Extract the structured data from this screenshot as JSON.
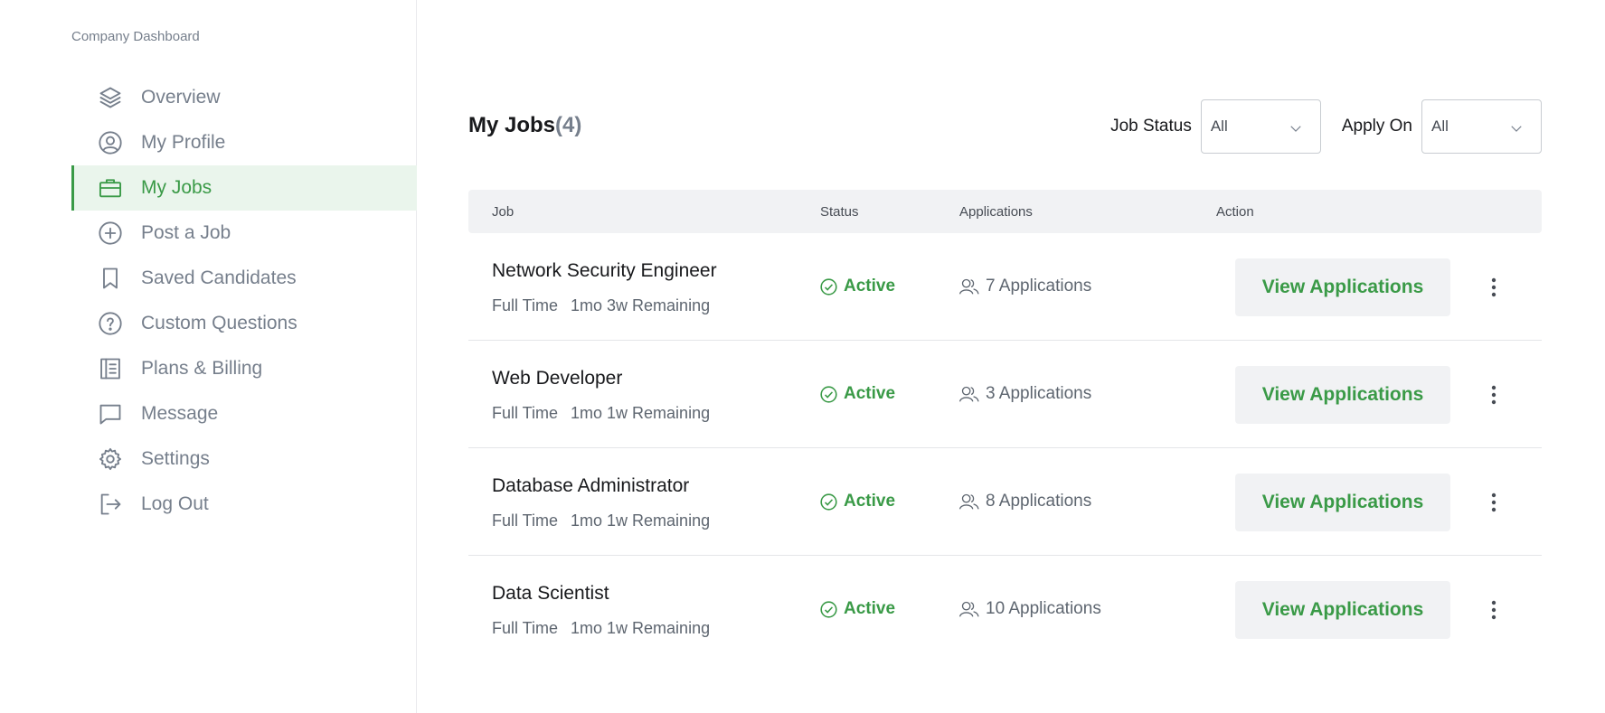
{
  "sidebar": {
    "heading": "Company Dashboard",
    "items": [
      {
        "label": "Overview",
        "icon": "layers-icon"
      },
      {
        "label": "My Profile",
        "icon": "user-circle-icon"
      },
      {
        "label": "My Jobs",
        "icon": "briefcase-icon",
        "active": true
      },
      {
        "label": "Post a Job",
        "icon": "plus-circle-icon"
      },
      {
        "label": "Saved Candidates",
        "icon": "bookmark-icon"
      },
      {
        "label": "Custom Questions",
        "icon": "question-circle-icon"
      },
      {
        "label": "Plans & Billing",
        "icon": "notebook-icon"
      },
      {
        "label": "Message",
        "icon": "chat-icon"
      },
      {
        "label": "Settings",
        "icon": "gear-icon"
      },
      {
        "label": "Log Out",
        "icon": "logout-icon"
      }
    ]
  },
  "header": {
    "title": "My Jobs",
    "count": "(4)"
  },
  "filters": {
    "job_status_label": "Job Status",
    "job_status_value": "All",
    "apply_on_label": "Apply On",
    "apply_on_value": "All"
  },
  "table": {
    "columns": {
      "job": "Job",
      "status": "Status",
      "applications": "Applications",
      "action": "Action"
    },
    "rows": [
      {
        "title": "Network Security Engineer",
        "type": "Full Time",
        "remaining": "1mo 3w Remaining",
        "status": "Active",
        "applications": "7 Applications",
        "action": "View Applications"
      },
      {
        "title": "Web Developer",
        "type": "Full Time",
        "remaining": "1mo 1w Remaining",
        "status": "Active",
        "applications": "3 Applications",
        "action": "View Applications"
      },
      {
        "title": "Database Administrator",
        "type": "Full Time",
        "remaining": "1mo 1w Remaining",
        "status": "Active",
        "applications": "8 Applications",
        "action": "View Applications"
      },
      {
        "title": "Data Scientist",
        "type": "Full Time",
        "remaining": "1mo 1w Remaining",
        "status": "Active",
        "applications": "10 Applications",
        "action": "View Applications"
      }
    ]
  },
  "colors": {
    "accent": "#3a9a47",
    "accent_bg": "#eaf5ec",
    "muted_text": "#767f8c",
    "header_bg": "#f1f2f4"
  }
}
